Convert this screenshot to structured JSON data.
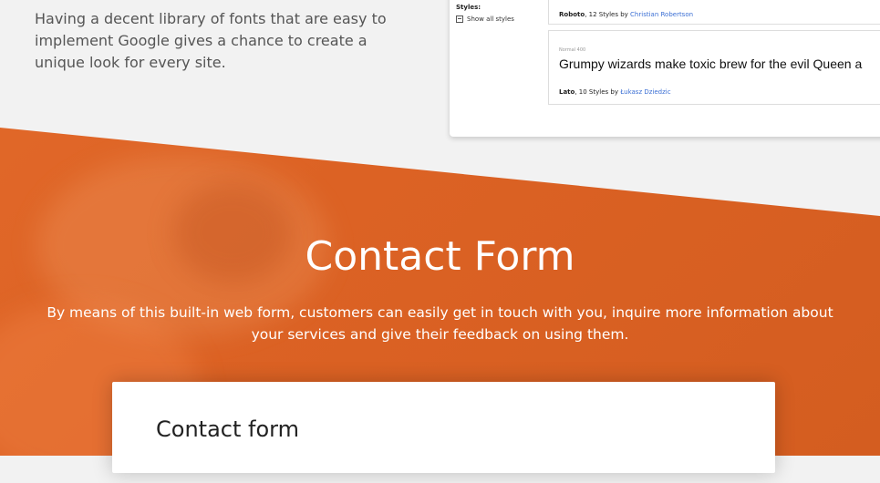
{
  "intro": {
    "text": "Having a decent library of fonts that are easy to implement Google gives a chance to create a unique look for every site."
  },
  "font_preview": {
    "styles_heading": "Styles:",
    "show_all_label": "Show all styles",
    "entries": [
      {
        "name": "Roboto",
        "styles": ", 12 Styles by ",
        "author": "Christian Robertson"
      },
      {
        "weight": "Normal 400",
        "sample": "Grumpy wizards make toxic brew for the evil Queen a",
        "name": "Lato",
        "styles": ", 10 Styles by ",
        "author": "Łukasz Dziedzic"
      }
    ]
  },
  "contact_section": {
    "title": "Contact Form",
    "description": "By means of this built-in web form, customers can easily get in touch with you, inquire more information about your services and give their feedback on using them.",
    "form_title": "Contact form"
  },
  "colors": {
    "accent": "#dc6224",
    "author_link": "#3b6fd4"
  }
}
